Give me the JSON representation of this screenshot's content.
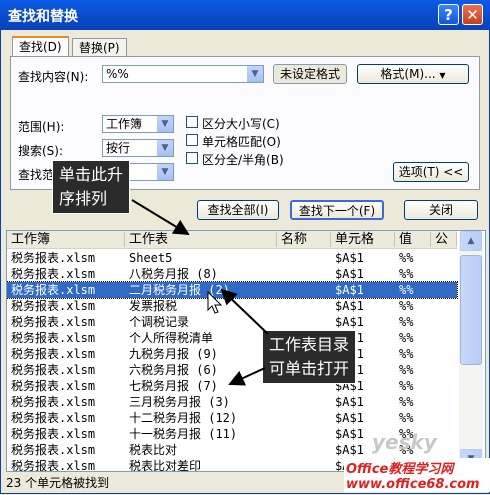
{
  "window": {
    "title": "查找和替换",
    "help_glyph": "?",
    "close_glyph": "✕"
  },
  "tabs": [
    {
      "label": "查找(D)"
    },
    {
      "label": "替换(P)"
    }
  ],
  "find": {
    "label": "查找内容(N):",
    "value": "%%",
    "format_status": "未设定格式",
    "format_button": "格式(M)..."
  },
  "options": {
    "scope_label": "范围(H):",
    "scope_value": "工作簿",
    "search_label": "搜索(S):",
    "search_value": "按行",
    "lookin_label": "查找范",
    "lookin_value": "",
    "match_case": "区分大小写(C)",
    "match_cell": "单元格匹配(O)",
    "match_width": "区分全/半角(B)",
    "options_button": "选项(T) <<"
  },
  "buttons": {
    "find_all": "查找全部(I)",
    "find_next": "查找下一个(F)",
    "close": "关闭"
  },
  "results": {
    "columns": [
      "工作簿",
      "工作表",
      "名称",
      "单元格",
      "值",
      "公"
    ],
    "rows": [
      [
        "税务报表.xlsm",
        "Sheet5",
        "",
        "$A$1",
        "%%"
      ],
      [
        "税务报表.xlsm",
        "八税务月报 (8)",
        "",
        "$A$1",
        "%%"
      ],
      [
        "税务报表.xlsm",
        "二月税务月报 (2)",
        "",
        "$A$1",
        "%%"
      ],
      [
        "税务报表.xlsm",
        "发票报税",
        "",
        "$A$1",
        "%%"
      ],
      [
        "税务报表.xlsm",
        "个调税记录",
        "",
        "$A$1",
        "%%"
      ],
      [
        "税务报表.xlsm",
        "个人所得税清单",
        "",
        "$A$1",
        "%%"
      ],
      [
        "税务报表.xlsm",
        "九税务月报 (9)",
        "",
        "$A$1",
        "%%"
      ],
      [
        "税务报表.xlsm",
        "六税务月报 (6)",
        "",
        "$A$1",
        "%%"
      ],
      [
        "税务报表.xlsm",
        "七税务月报 (7)",
        "",
        "$A$1",
        "%%"
      ],
      [
        "税务报表.xlsm",
        "三月税务月报 (3)",
        "",
        "$A$1",
        "%%"
      ],
      [
        "税务报表.xlsm",
        "十二税务月报 (12)",
        "",
        "$A$1",
        "%%"
      ],
      [
        "税务报表.xlsm",
        "十一税务月报 (11)",
        "",
        "$A$1",
        "%%"
      ],
      [
        "税务报表.xlsm",
        "税表比对",
        "",
        "$A$1",
        "%%"
      ],
      [
        "税务报表.xlsm",
        "税表比对差印",
        "",
        "$A$1",
        "%%"
      ]
    ],
    "selected_index": 2
  },
  "status": "23 个单元格被找到",
  "callouts": {
    "sort": "单击此升\n序排列",
    "open": "工作表目录\n可单击打开"
  },
  "watermark": {
    "yesky": "yesky",
    "office": "Office教程学习网 www.office68.com"
  },
  "colors": {
    "title_bar": "#0b4fd0",
    "selection": "#316ac5",
    "face": "#ece9d8"
  }
}
